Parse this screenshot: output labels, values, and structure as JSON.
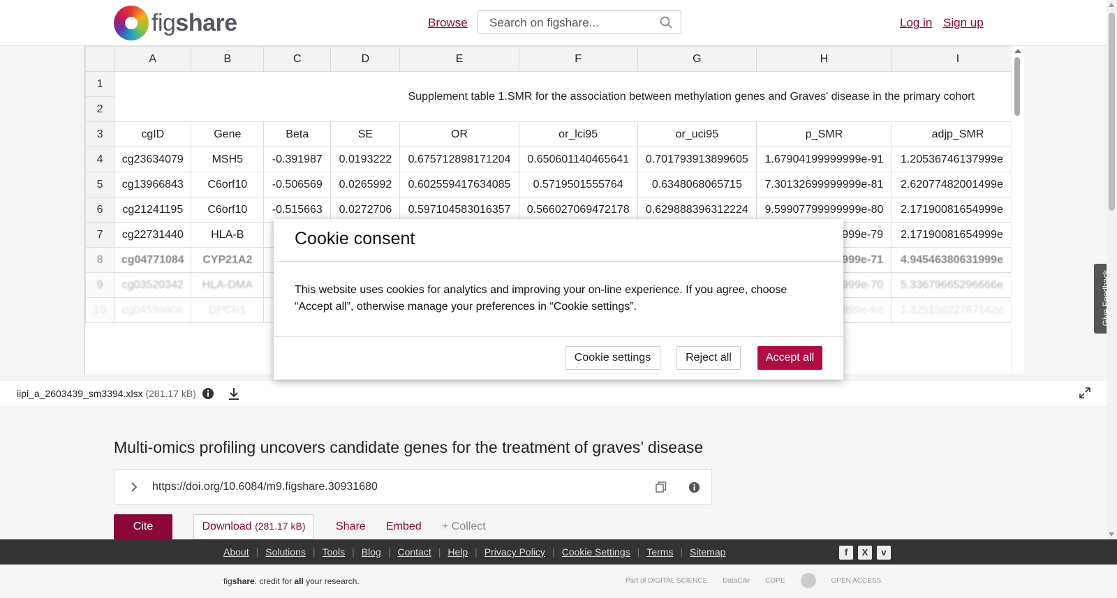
{
  "header": {
    "logo_text_a": "fig",
    "logo_text_b": "share",
    "browse": "Browse",
    "search_placeholder": "Search on figshare...",
    "login": "Log in",
    "signup": "Sign up"
  },
  "sheet": {
    "columns": [
      "A",
      "B",
      "C",
      "D",
      "E",
      "F",
      "G",
      "H",
      "I"
    ],
    "merged_title": "Supplement table 1.SMR for the association between methylation genes and Graves' disease in the primary cohort",
    "row_numbers": [
      "1",
      "2",
      "3",
      "4",
      "5",
      "6",
      "7",
      "8",
      "9",
      "10"
    ],
    "headers": [
      "cgID",
      "Gene",
      "Beta",
      "SE",
      "OR",
      "or_lci95",
      "or_uci95",
      "p_SMR",
      "adjp_SMR"
    ],
    "rows": [
      [
        "cg23634079",
        "MSH5",
        "-0.391987",
        "0.0193222",
        "0.675712898171204",
        "0.650601140465641",
        "0.701793913899605",
        "1.67904199999999e-91",
        "1.20536746137999e"
      ],
      [
        "cg13966843",
        "C6orf10",
        "-0.506569",
        "0.0265992",
        "0.602559417634085",
        "0.5719501555764",
        "0.6348068065715",
        "7.30132699999999e-81",
        "2.62077482001499e"
      ],
      [
        "cg21241195",
        "C6orf10",
        "-0.515663",
        "0.0272706",
        "0.597104583016357",
        "0.566027069472178",
        "0.629888396312224",
        "9.59907799999999e-80",
        "2.17190081654999e"
      ],
      [
        "cg22731440",
        "HLA-B",
        "",
        "",
        "",
        "",
        "",
        "99999e-79",
        "2.17190081654999e"
      ],
      [
        "cg04771084",
        "CYP21A2",
        "",
        "",
        "",
        "",
        "",
        "99999e-71",
        "4.94546380631999e"
      ],
      [
        "cg03520342",
        "HLA-DMA",
        "",
        "",
        "",
        "",
        "",
        "99999e-70",
        "5.33679665296666e"
      ],
      [
        "cg04559908",
        "DPCR1",
        "",
        "",
        "",
        "",
        "",
        "99999e-69",
        "1.32515022767142e"
      ]
    ]
  },
  "file": {
    "name": "iipi_a_2603439_sm3394.xlsx",
    "size": "(281.17 kB)"
  },
  "cookie": {
    "title": "Cookie consent",
    "text": "This website uses cookies for analytics and improving your on-line experience. If you agree, choose “Accept all”, otherwise manage your preferences in “Cookie settings”.",
    "settings": "Cookie settings",
    "reject": "Reject all",
    "accept": "Accept all"
  },
  "feedback": "Give Feedback",
  "article": {
    "title": "Multi-omics profiling uncovers candidate genes for the treatment of graves’ disease",
    "doi": "https://doi.org/10.6084/m9.figshare.30931680",
    "cite": "Cite",
    "download": "Download",
    "download_size": "(281.17 kB)",
    "share": "Share",
    "embed": "Embed",
    "collect": "+ Collect"
  },
  "footer": {
    "links": [
      "About",
      "Solutions",
      "Tools",
      "Blog",
      "Contact",
      "Help",
      "Privacy Policy",
      "Cookie Settings",
      "Terms",
      "Sitemap"
    ],
    "credit_a": "fig",
    "credit_b": "share",
    "credit_c": ". credit for ",
    "credit_d": "all",
    "credit_e": " your research.",
    "partners": [
      "Part of DIGITAL SCIENCE",
      "DataCite",
      "COPE",
      "",
      "OPEN ACCESS"
    ]
  },
  "colors": {
    "brand": "#8a0838",
    "accept": "#b00d47"
  }
}
